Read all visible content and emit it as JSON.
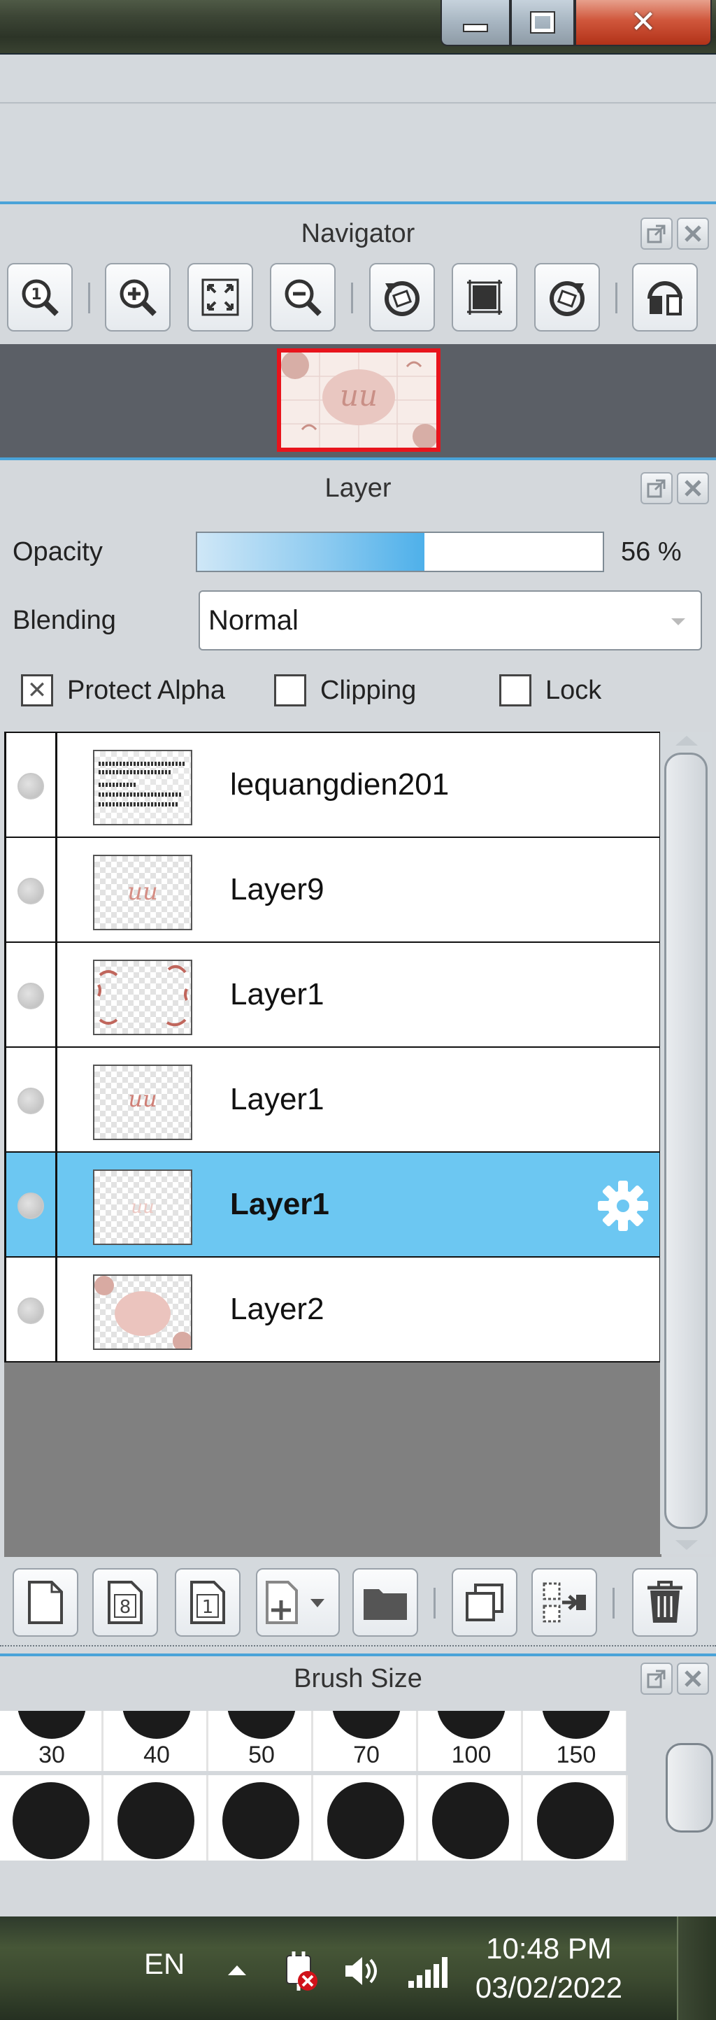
{
  "window": {
    "controls": {
      "minimize_icon": "minimize-icon",
      "maximize_icon": "restore-icon",
      "close_icon": "close-icon",
      "close_glyph": "✕"
    }
  },
  "navigator": {
    "title": "Navigator",
    "tools": [
      {
        "name": "zoom-100-icon"
      },
      {
        "name": "zoom-in-icon"
      },
      {
        "name": "fit-screen-icon"
      },
      {
        "name": "zoom-out-icon"
      },
      {
        "name": "rotate-left-icon"
      },
      {
        "name": "reset-rotation-icon"
      },
      {
        "name": "rotate-right-icon"
      },
      {
        "name": "flip-horizontal-icon"
      }
    ]
  },
  "layer_panel": {
    "title": "Layer",
    "opacity_label": "Opacity",
    "opacity_value": "56 %",
    "opacity_fraction": 0.56,
    "blending_label": "Blending",
    "blending_value": "Normal",
    "protect_alpha": {
      "label": "Protect Alpha",
      "checked": true,
      "glyph": "✕"
    },
    "clipping": {
      "label": "Clipping",
      "checked": false
    },
    "lock": {
      "label": "Lock",
      "checked": false
    },
    "layers": [
      {
        "name": "lequangdien201",
        "selected": false,
        "thumb": "text"
      },
      {
        "name": "Layer9",
        "selected": false,
        "thumb": "script"
      },
      {
        "name": "Layer1",
        "selected": false,
        "thumb": "frame"
      },
      {
        "name": "Layer1",
        "selected": false,
        "thumb": "script"
      },
      {
        "name": "Layer1",
        "selected": true,
        "thumb": "faint"
      },
      {
        "name": "Layer2",
        "selected": false,
        "thumb": "blob"
      }
    ],
    "tools": [
      {
        "name": "new-layer-icon"
      },
      {
        "name": "new-8bit-layer-icon",
        "glyph": "8"
      },
      {
        "name": "new-1bit-layer-icon",
        "glyph": "1"
      },
      {
        "name": "add-layer-menu-icon"
      },
      {
        "name": "new-folder-icon"
      },
      {
        "name": "duplicate-layer-icon"
      },
      {
        "name": "merge-down-icon"
      },
      {
        "name": "delete-layer-icon"
      }
    ]
  },
  "brush_panel": {
    "title": "Brush Size",
    "sizes": [
      "30",
      "40",
      "50",
      "70",
      "100",
      "150"
    ]
  },
  "taskbar": {
    "language": "EN",
    "time": "10:48 PM",
    "date": "03/02/2022"
  },
  "colors": {
    "accent_blue": "#4aa3d8",
    "selected_row": "#6cc7f2",
    "thumb_border": "#e8141c"
  }
}
